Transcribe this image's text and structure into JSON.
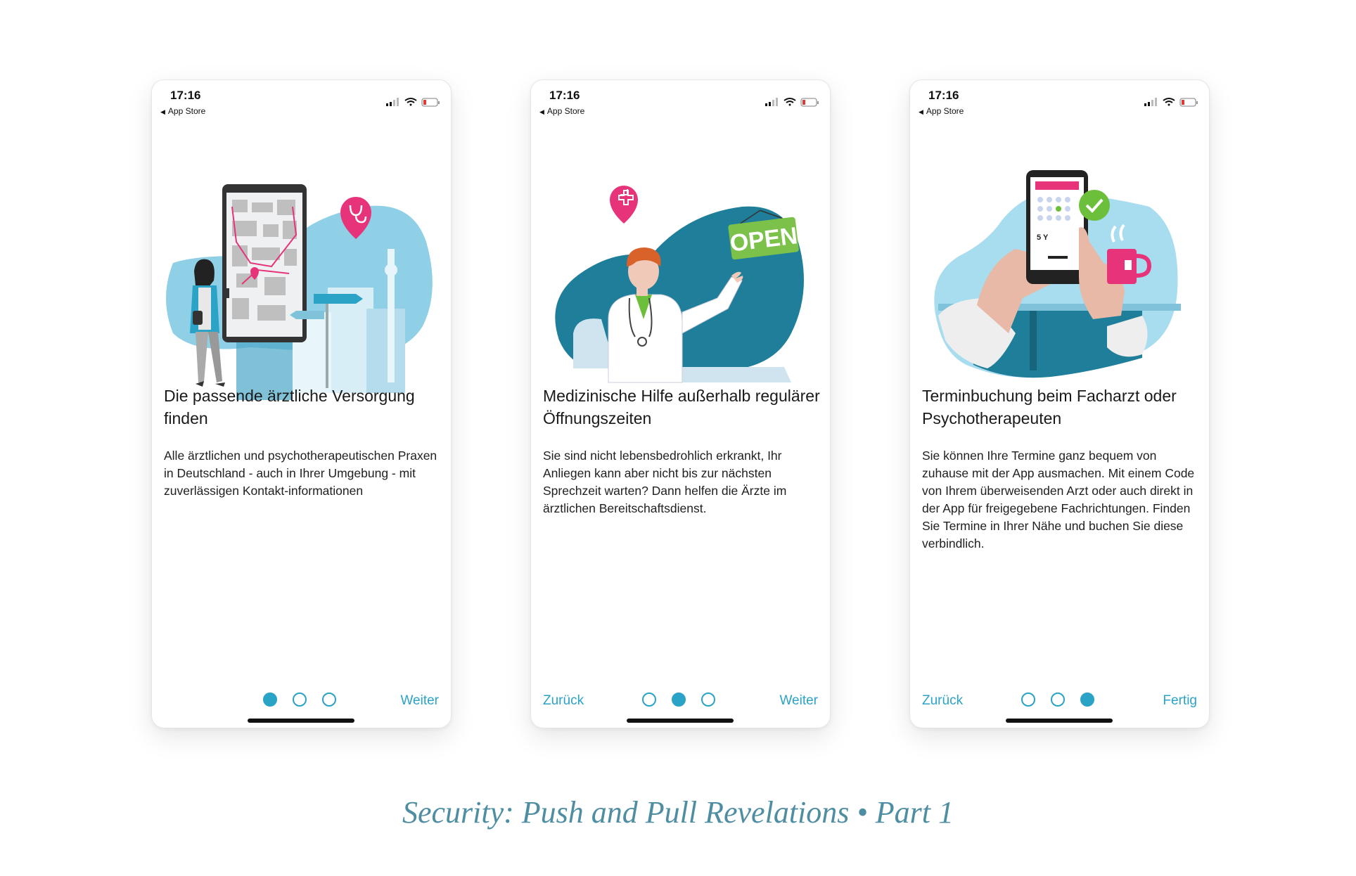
{
  "status_bar": {
    "time": "17:16",
    "back_label": "App Store"
  },
  "screens": [
    {
      "title": "Die passende ärztliche Versorgung finden",
      "body": "Alle ärztlichen und psychotherapeutischen Praxen in Deutschland - auch in Ihrer Umgebung - mit zuverlässigen Kontakt-informationen",
      "back_label": "",
      "next_label": "Weiter",
      "active_dot": 0
    },
    {
      "title": "Medizinische Hilfe außerhalb regulärer Öffnungszeiten",
      "body": "Sie sind nicht lebensbedrohlich erkrankt, Ihr Anliegen kann aber nicht bis zur nächsten Sprechzeit warten? Dann helfen die Ärzte im ärztlichen Bereitschaftsdienst.",
      "back_label": "Zurück",
      "next_label": "Weiter",
      "active_dot": 1,
      "sign_text": "OPEN"
    },
    {
      "title": "Terminbuchung beim Facharzt oder Psychotherapeuten",
      "body": "Sie können Ihre Termine ganz bequem von zuhause mit der App ausmachen. Mit einem Code von Ihrem überweisenden Arzt oder auch direkt in der App für freigegebene Fachrichtungen. Finden Sie Termine in Ihrer Nähe und buchen Sie diese verbindlich.",
      "back_label": "Zurück",
      "next_label": "Fertig",
      "active_dot": 2,
      "code_text": "5 Y"
    }
  ],
  "caption": "Security: Push and Pull Revelations • Part 1",
  "colors": {
    "accent": "#2aa3c6",
    "pink": "#e6337a",
    "teal_dark": "#1f7e99",
    "light_blue": "#8fd0e6",
    "caption": "#4f8ea2"
  },
  "icons": [
    "signal-icon",
    "wifi-icon",
    "battery-icon",
    "back-triangle-icon",
    "map-pin-icon",
    "cross-pin-icon",
    "check-icon"
  ]
}
